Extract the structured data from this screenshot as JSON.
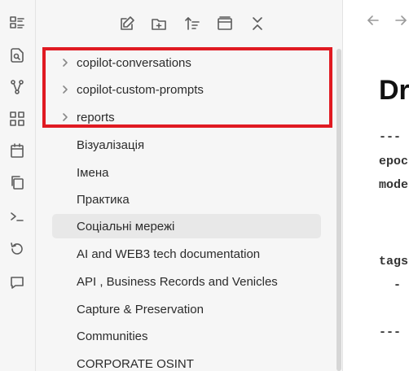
{
  "ribbon": {
    "icons": [
      "file-tree-icon",
      "search-icon",
      "graph-icon",
      "canvas-icon",
      "calendar-icon",
      "copy-icon",
      "terminal-icon",
      "history-icon",
      "comment-icon"
    ]
  },
  "toolbar": {
    "icons": [
      "new-note-icon",
      "new-folder-icon",
      "sort-icon",
      "auto-reveal-icon",
      "collapse-all-icon"
    ]
  },
  "tree": {
    "items": [
      {
        "label": "copilot-conversations",
        "folder": true
      },
      {
        "label": "copilot-custom-prompts",
        "folder": true
      },
      {
        "label": "reports",
        "folder": true
      },
      {
        "label": "Візуалізація",
        "folder": false
      },
      {
        "label": "Імена",
        "folder": false
      },
      {
        "label": "Практика",
        "folder": false
      },
      {
        "label": "Соціальні мережі",
        "folder": false,
        "active": true
      },
      {
        "label": "AI and WEB3 tech documentation",
        "folder": false
      },
      {
        "label": "API , Business Records and Venicles",
        "folder": false
      },
      {
        "label": "Capture & Preservation",
        "folder": false
      },
      {
        "label": "Communities",
        "folder": false
      },
      {
        "label": "CORPORATE OSINT",
        "folder": false
      }
    ]
  },
  "editor": {
    "title": "Dr",
    "lines": [
      "---",
      "epoc",
      "mode",
      "tags",
      "  -",
      "---"
    ]
  },
  "colors": {
    "highlight_border": "#e01a22",
    "active_row": "#e8e8e8",
    "sidebar_bg": "#f6f6f6"
  }
}
